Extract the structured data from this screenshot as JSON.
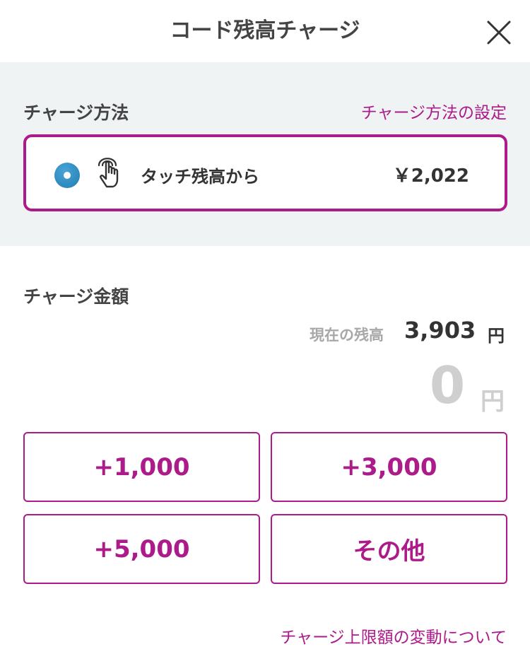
{
  "header": {
    "title": "コード残高チャージ",
    "close_icon": "close-icon"
  },
  "method": {
    "label": "チャージ方法",
    "settings_link": "チャージ方法の設定",
    "selected": {
      "name": "タッチ残高から",
      "amount": "￥2,022",
      "icon": "touch-hand-icon"
    }
  },
  "amount": {
    "label": "チャージ金額",
    "current_balance_label": "現在の残高",
    "current_balance_value": "3,903",
    "current_balance_unit": "円",
    "charge_value": "0",
    "charge_unit": "円",
    "buttons": [
      "+1,000",
      "+3,000",
      "+5,000",
      "その他"
    ]
  },
  "footer": {
    "limit_link": "チャージ上限額の変動について"
  },
  "colors": {
    "accent": "#ad1a8a",
    "radio": "#1e7eb0",
    "section_bg": "#f0f3f4"
  }
}
